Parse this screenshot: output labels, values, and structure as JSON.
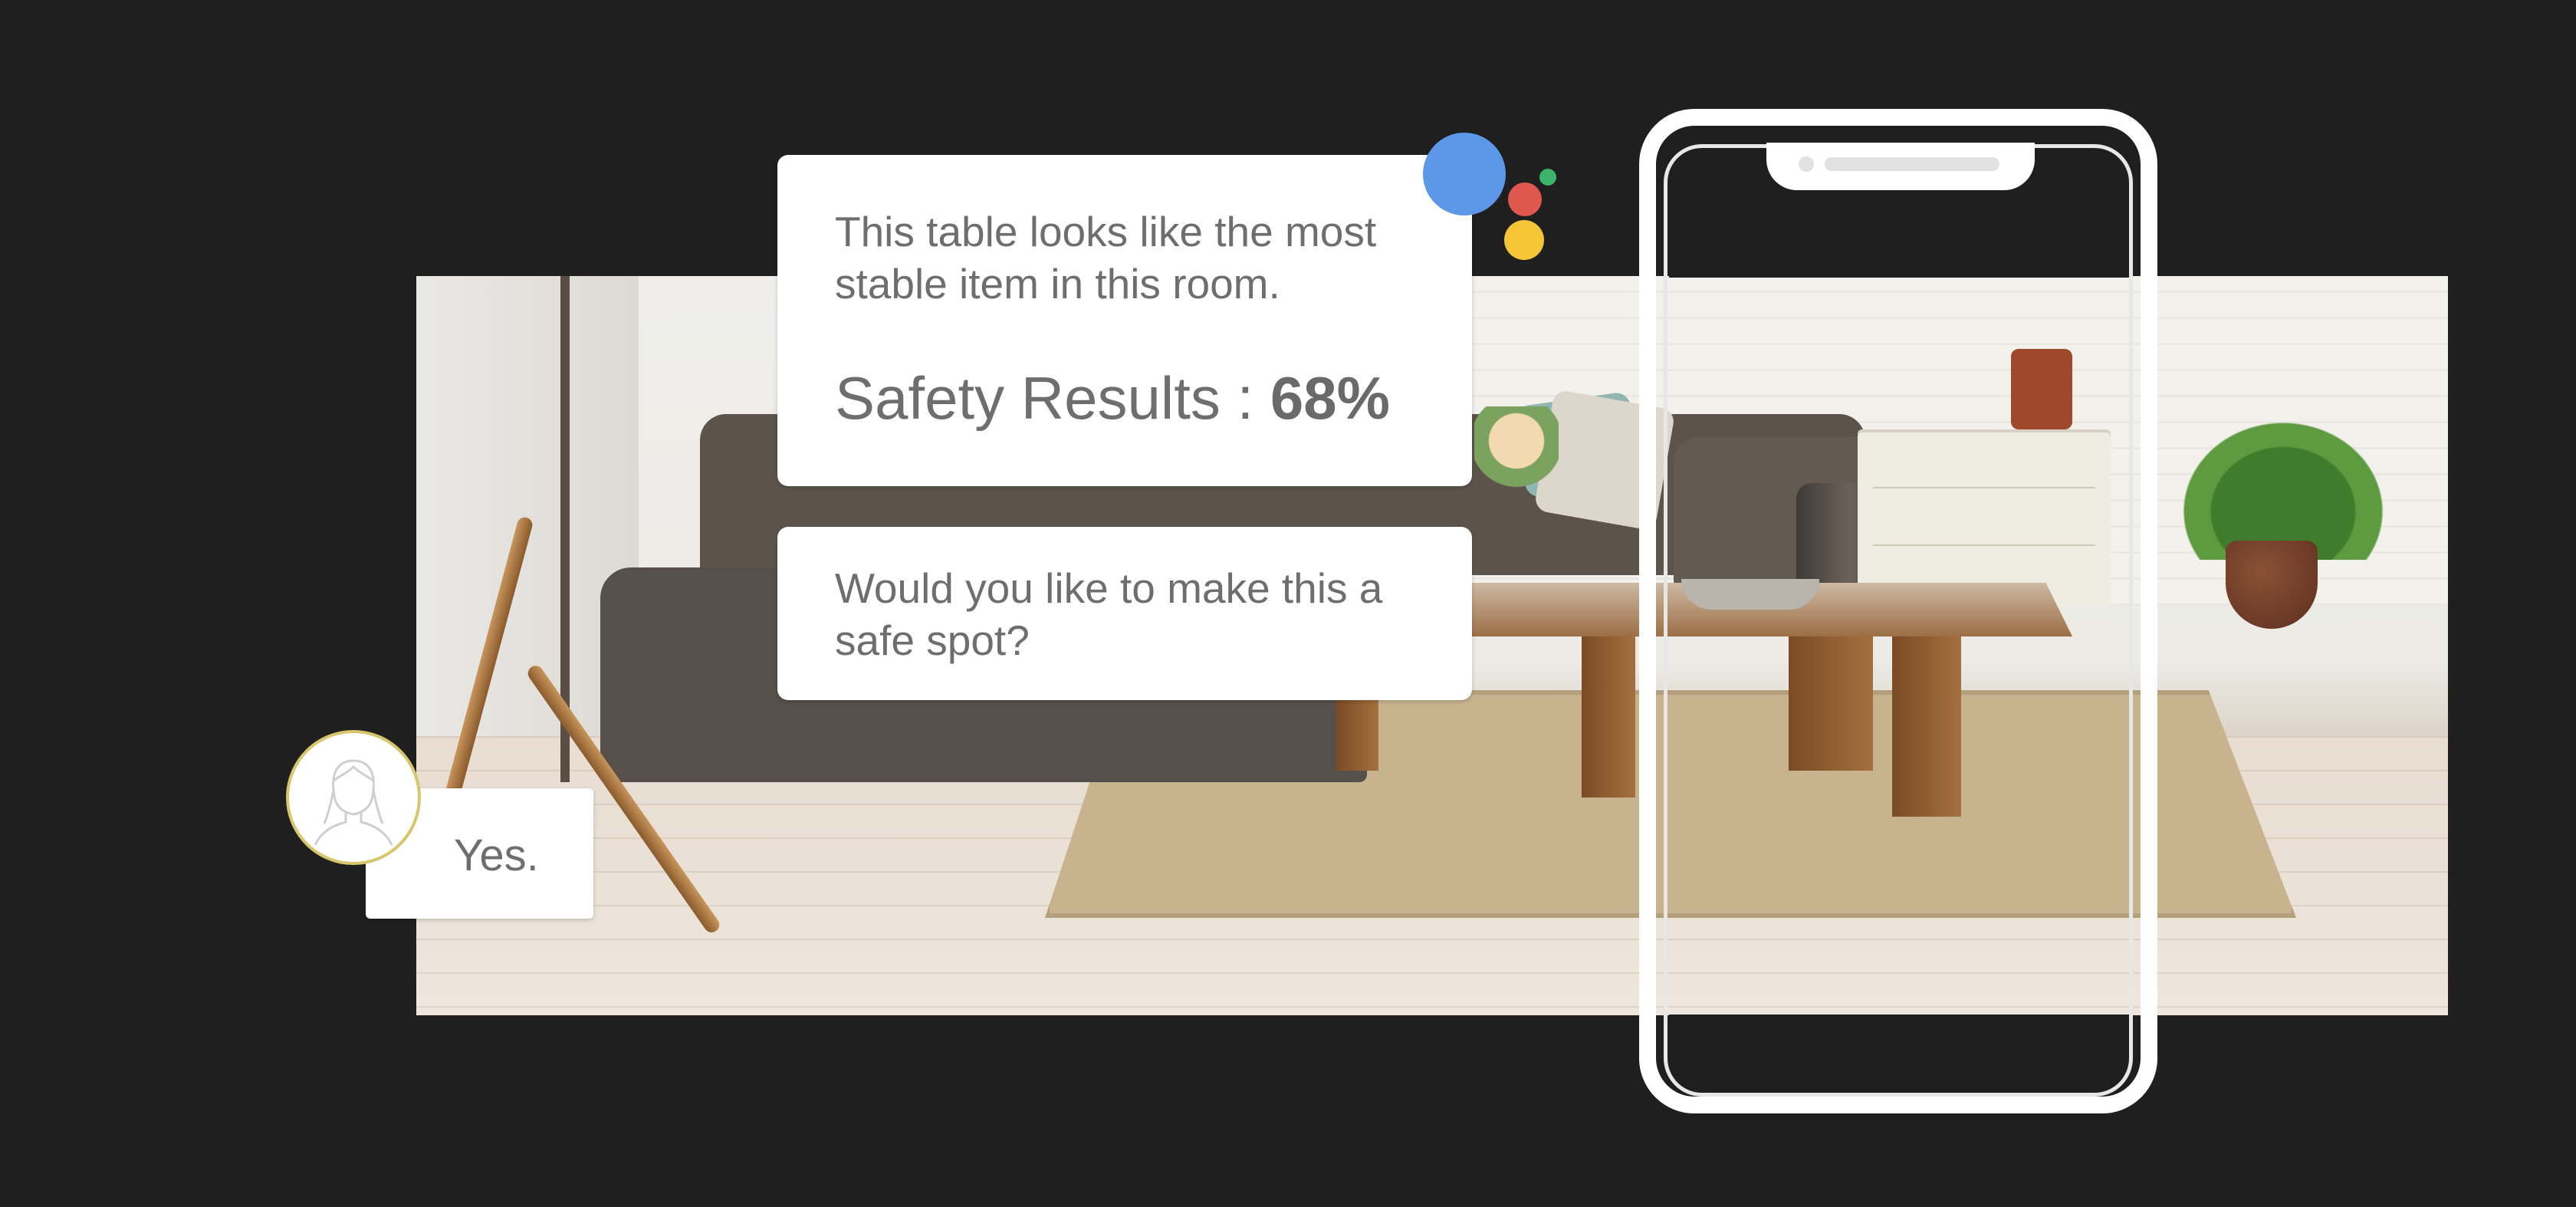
{
  "assistant": {
    "message": "This table looks like the most stable item in this room.",
    "safety_label": "Safety Results :",
    "safety_value": "68%",
    "question": "Would you like to make this a safe spot?"
  },
  "user": {
    "reply": "Yes."
  },
  "assistant_logo_colors": {
    "blue": "#5c97e8",
    "red": "#e0574e",
    "yellow": "#f3c537",
    "green": "#3bb36a"
  },
  "avatar_icon": "user-outline-icon",
  "background_color": "#1f1f1f"
}
